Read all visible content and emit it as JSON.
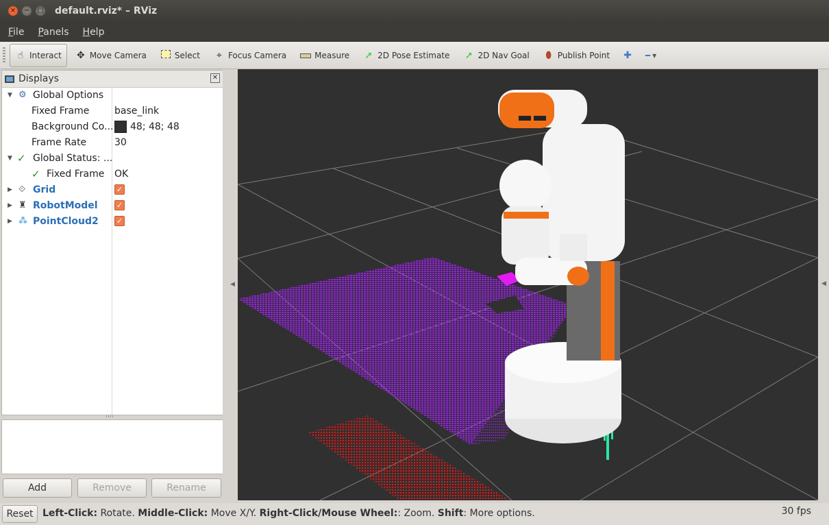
{
  "window": {
    "title": "default.rviz* – RViz",
    "close_glyph": "×",
    "minimize_glyph": "−",
    "maximize_glyph": "□"
  },
  "menu": [
    {
      "label": "File",
      "mnemonic": "F",
      "rest": "ile"
    },
    {
      "label": "Panels",
      "mnemonic": "P",
      "rest": "anels"
    },
    {
      "label": "Help",
      "mnemonic": "H",
      "rest": "elp"
    }
  ],
  "toolbar": {
    "tools": [
      {
        "name": "interact",
        "label": "Interact",
        "icon": "hand-icon",
        "active": true
      },
      {
        "name": "move-camera",
        "label": "Move Camera",
        "icon": "move-icon",
        "active": false
      },
      {
        "name": "select",
        "label": "Select",
        "icon": "select-box-icon",
        "active": false
      },
      {
        "name": "focus-camera",
        "label": "Focus Camera",
        "icon": "focus-icon",
        "active": false
      },
      {
        "name": "measure",
        "label": "Measure",
        "icon": "ruler-icon",
        "active": false
      },
      {
        "name": "2d-pose-estimate",
        "label": "2D Pose Estimate",
        "icon": "green-arrow-icon",
        "active": false
      },
      {
        "name": "2d-nav-goal",
        "label": "2D Nav Goal",
        "icon": "green-arrow-icon",
        "active": false
      },
      {
        "name": "publish-point",
        "label": "Publish Point",
        "icon": "map-pin-icon",
        "active": false
      }
    ],
    "add_tool_glyph": "✚",
    "remove_tool_glyph": "━",
    "dropdown_glyph": "▾"
  },
  "displays_panel": {
    "title": "Displays",
    "close_glyph": "✕",
    "tree": {
      "global_options": {
        "label": "Global Options",
        "fixed_frame_label": "Fixed Frame",
        "fixed_frame_value": "base_link",
        "background_label": "Background Co...",
        "background_value": "48; 48; 48",
        "background_color": "#303030",
        "frame_rate_label": "Frame Rate",
        "frame_rate_value": "30"
      },
      "global_status": {
        "label": "Global Status: ...",
        "fixed_frame_label": "Fixed Frame",
        "fixed_frame_value": "OK"
      },
      "displays": [
        {
          "label": "Grid",
          "icon": "grid-icon",
          "enabled": true
        },
        {
          "label": "RobotModel",
          "icon": "robot-icon",
          "enabled": true
        },
        {
          "label": "PointCloud2",
          "icon": "pointcloud-icon",
          "enabled": true
        }
      ]
    },
    "buttons": {
      "add": "Add",
      "remove": "Remove",
      "rename": "Rename"
    }
  },
  "viewport": {
    "background_color": "#303030",
    "grid_color": "#a0a0a0",
    "cloud_colors": {
      "table": "#a020f0",
      "floor": "#ff0000",
      "small": "#2ee6a0"
    },
    "robot_colors": {
      "body": "#f4f4f4",
      "accent": "#f07018"
    }
  },
  "status_bar": {
    "reset": "Reset",
    "hint_parts": [
      {
        "b": "Left-Click:",
        "t": " Rotate. "
      },
      {
        "b": "Middle-Click:",
        "t": " Move X/Y. "
      },
      {
        "b": "Right-Click/Mouse Wheel:",
        "t": ": Zoom. "
      },
      {
        "b": "Shift",
        "t": ": More options."
      }
    ],
    "fps": "30 fps"
  },
  "check_glyph": "✓",
  "expand_open": "▼",
  "expand_closed": "▶"
}
